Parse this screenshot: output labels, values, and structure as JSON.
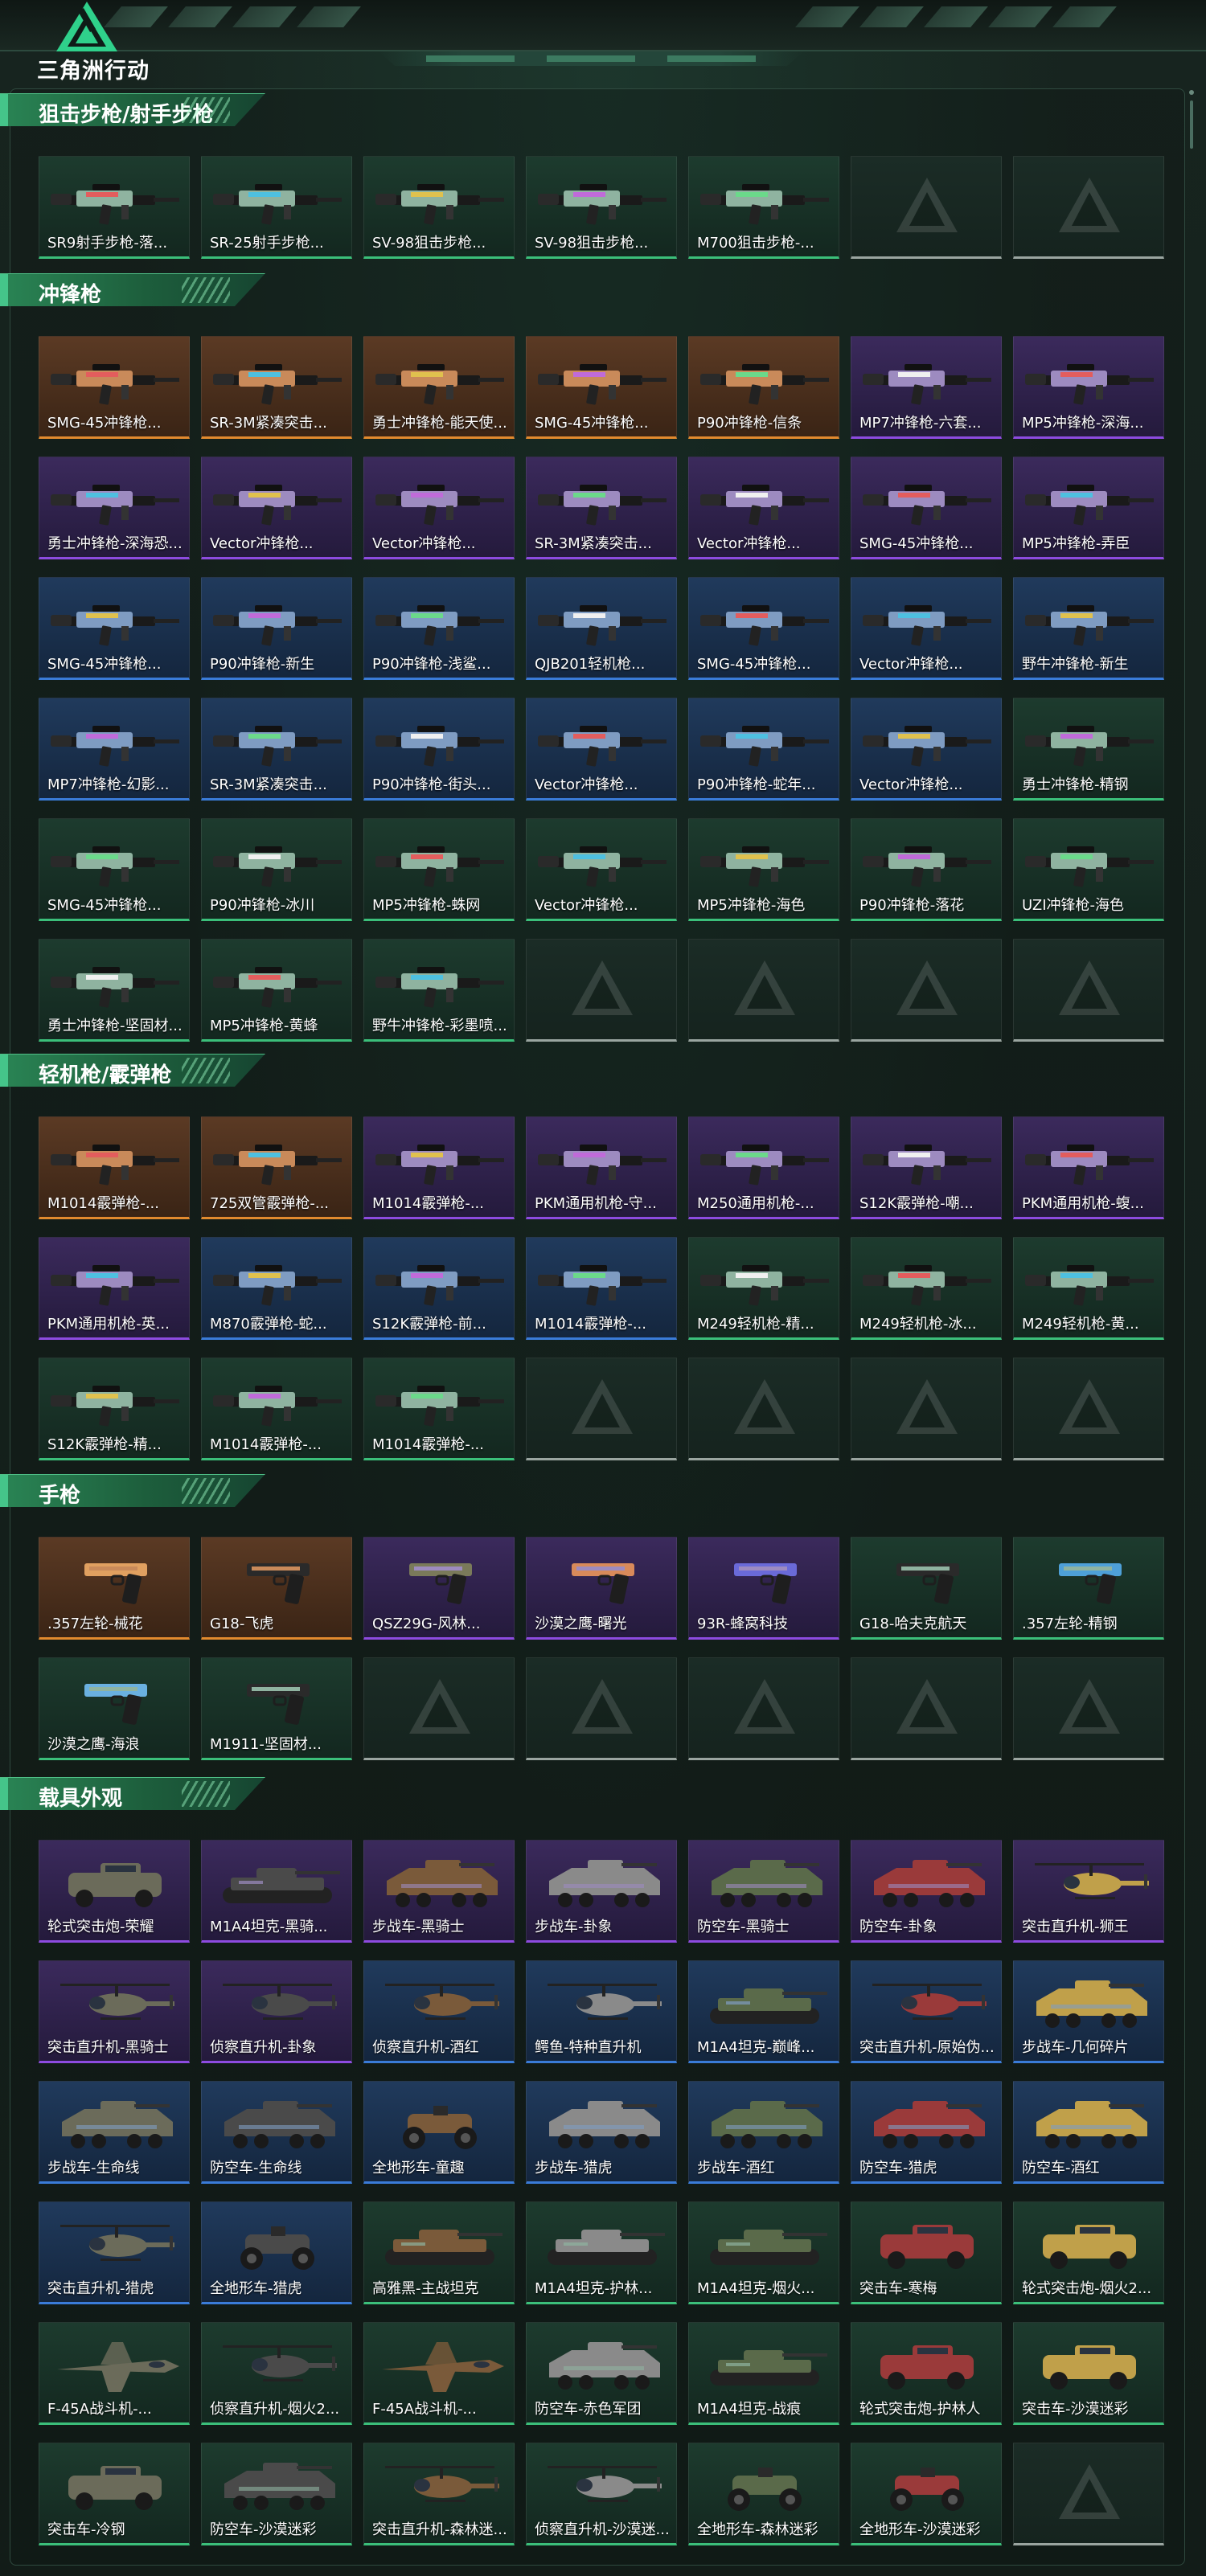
{
  "brand": {
    "name": "三角洲行动"
  },
  "sections": [
    {
      "title": "狙击步枪/射手步枪",
      "type": "gun",
      "items": [
        {
          "name": "SR9射手步枪-落...",
          "rarity": "green"
        },
        {
          "name": "SR-25射手步枪...",
          "rarity": "green"
        },
        {
          "name": "SV-98狙击步枪...",
          "rarity": "green"
        },
        {
          "name": "SV-98狙击步枪...",
          "rarity": "green"
        },
        {
          "name": "M700狙击步枪-...",
          "rarity": "green"
        }
      ],
      "empty_slots": 2
    },
    {
      "title": "冲锋枪",
      "type": "smg",
      "items": [
        {
          "name": "SMG-45冲锋枪...",
          "rarity": "orange"
        },
        {
          "name": "SR-3M紧凑突击...",
          "rarity": "orange"
        },
        {
          "name": "勇士冲锋枪-能天使...",
          "rarity": "orange"
        },
        {
          "name": "SMG-45冲锋枪...",
          "rarity": "orange"
        },
        {
          "name": "P90冲锋枪-信条",
          "rarity": "orange"
        },
        {
          "name": "MP7冲锋枪-六套...",
          "rarity": "purple"
        },
        {
          "name": "MP5冲锋枪-深海...",
          "rarity": "purple"
        },
        {
          "name": "勇士冲锋枪-深海恐...",
          "rarity": "purple"
        },
        {
          "name": "Vector冲锋枪...",
          "rarity": "purple"
        },
        {
          "name": "Vector冲锋枪...",
          "rarity": "purple"
        },
        {
          "name": "SR-3M紧凑突击...",
          "rarity": "purple"
        },
        {
          "name": "Vector冲锋枪...",
          "rarity": "purple"
        },
        {
          "name": "SMG-45冲锋枪...",
          "rarity": "purple"
        },
        {
          "name": "MP5冲锋枪-弄臣",
          "rarity": "purple"
        },
        {
          "name": "SMG-45冲锋枪...",
          "rarity": "blue"
        },
        {
          "name": "P90冲锋枪-新生",
          "rarity": "blue"
        },
        {
          "name": "P90冲锋枪-浅鲨...",
          "rarity": "blue"
        },
        {
          "name": "QJB201轻机枪...",
          "rarity": "blue"
        },
        {
          "name": "SMG-45冲锋枪...",
          "rarity": "blue"
        },
        {
          "name": "Vector冲锋枪...",
          "rarity": "blue"
        },
        {
          "name": "野牛冲锋枪-新生",
          "rarity": "blue"
        },
        {
          "name": "MP7冲锋枪-幻影...",
          "rarity": "blue"
        },
        {
          "name": "SR-3M紧凑突击...",
          "rarity": "blue"
        },
        {
          "name": "P90冲锋枪-街头...",
          "rarity": "blue"
        },
        {
          "name": "Vector冲锋枪...",
          "rarity": "blue"
        },
        {
          "name": "P90冲锋枪-蛇年...",
          "rarity": "blue"
        },
        {
          "name": "Vector冲锋枪...",
          "rarity": "blue"
        },
        {
          "name": "勇士冲锋枪-精钢",
          "rarity": "green"
        },
        {
          "name": "SMG-45冲锋枪...",
          "rarity": "green"
        },
        {
          "name": "P90冲锋枪-冰川",
          "rarity": "green"
        },
        {
          "name": "MP5冲锋枪-蛛网",
          "rarity": "green"
        },
        {
          "name": "Vector冲锋枪...",
          "rarity": "green"
        },
        {
          "name": "MP5冲锋枪-海色",
          "rarity": "green"
        },
        {
          "name": "P90冲锋枪-落花",
          "rarity": "green"
        },
        {
          "name": "UZI冲锋枪-海色",
          "rarity": "green"
        },
        {
          "name": "勇士冲锋枪-坚固材...",
          "rarity": "green"
        },
        {
          "name": "MP5冲锋枪-黄蜂",
          "rarity": "green"
        },
        {
          "name": "野牛冲锋枪-彩墨喷...",
          "rarity": "green"
        }
      ],
      "empty_slots": 4
    },
    {
      "title": "轻机枪/霰弹枪",
      "type": "gun",
      "items": [
        {
          "name": "M1014霰弹枪-...",
          "rarity": "orange"
        },
        {
          "name": "725双管霰弹枪-...",
          "rarity": "orange"
        },
        {
          "name": "M1014霰弹枪-...",
          "rarity": "purple"
        },
        {
          "name": "PKM通用机枪-守...",
          "rarity": "purple"
        },
        {
          "name": "M250通用机枪-...",
          "rarity": "purple"
        },
        {
          "name": "S12K霰弹枪-嘲...",
          "rarity": "purple"
        },
        {
          "name": "PKM通用机枪-蝮...",
          "rarity": "purple"
        },
        {
          "name": "PKM通用机枪-英...",
          "rarity": "purple"
        },
        {
          "name": "M870霰弹枪-蛇...",
          "rarity": "blue"
        },
        {
          "name": "S12K霰弹枪-前...",
          "rarity": "blue"
        },
        {
          "name": "M1014霰弹枪-...",
          "rarity": "blue"
        },
        {
          "name": "M249轻机枪-精...",
          "rarity": "green"
        },
        {
          "name": "M249轻机枪-冰...",
          "rarity": "green"
        },
        {
          "name": "M249轻机枪-黄...",
          "rarity": "green"
        },
        {
          "name": "S12K霰弹枪-精...",
          "rarity": "green"
        },
        {
          "name": "M1014霰弹枪-...",
          "rarity": "green"
        },
        {
          "name": "M1014霰弹枪-...",
          "rarity": "green"
        }
      ],
      "empty_slots": 4
    },
    {
      "title": "手枪",
      "type": "pistol",
      "items": [
        {
          "name": ".357左轮-械花",
          "rarity": "orange"
        },
        {
          "name": "G18-飞虎",
          "rarity": "orange"
        },
        {
          "name": "QSZ29G-风林...",
          "rarity": "purple"
        },
        {
          "name": "沙漠之鹰-曙光",
          "rarity": "purple"
        },
        {
          "name": "93R-蜂窝科技",
          "rarity": "purple"
        },
        {
          "name": "G18-哈夫克航天",
          "rarity": "green"
        },
        {
          "name": ".357左轮-精钢",
          "rarity": "green"
        },
        {
          "name": "沙漠之鹰-海浪",
          "rarity": "green"
        },
        {
          "name": "M1911-坚固材...",
          "rarity": "green"
        }
      ],
      "empty_slots": 5
    },
    {
      "title": "载具外观",
      "type": "vehicle",
      "items": [
        {
          "name": "轮式突击炮-荣耀",
          "rarity": "purple",
          "vehicle": "car"
        },
        {
          "name": "M1A4坦克-黑骑...",
          "rarity": "purple",
          "vehicle": "tank"
        },
        {
          "name": "步战车-黑骑士",
          "rarity": "purple",
          "vehicle": "apc"
        },
        {
          "name": "步战车-卦象",
          "rarity": "purple",
          "vehicle": "apc"
        },
        {
          "name": "防空车-黑骑士",
          "rarity": "purple",
          "vehicle": "apc"
        },
        {
          "name": "防空车-卦象",
          "rarity": "purple",
          "vehicle": "apc"
        },
        {
          "name": "突击直升机-狮王",
          "rarity": "purple",
          "vehicle": "heli"
        },
        {
          "name": "突击直升机-黑骑士",
          "rarity": "purple",
          "vehicle": "heli"
        },
        {
          "name": "侦察直升机-卦象",
          "rarity": "purple",
          "vehicle": "heli"
        },
        {
          "name": "侦察直升机-酒红",
          "rarity": "blue",
          "vehicle": "heli"
        },
        {
          "name": "鳄鱼-特种直升机",
          "rarity": "blue",
          "vehicle": "heli"
        },
        {
          "name": "M1A4坦克-巅峰...",
          "rarity": "blue",
          "vehicle": "tank"
        },
        {
          "name": "突击直升机-原始伪...",
          "rarity": "blue",
          "vehicle": "heli"
        },
        {
          "name": "步战车-几何碎片",
          "rarity": "blue",
          "vehicle": "apc"
        },
        {
          "name": "步战车-生命线",
          "rarity": "blue",
          "vehicle": "apc"
        },
        {
          "name": "防空车-生命线",
          "rarity": "blue",
          "vehicle": "apc"
        },
        {
          "name": "全地形车-童趣",
          "rarity": "blue",
          "vehicle": "atv"
        },
        {
          "name": "步战车-猎虎",
          "rarity": "blue",
          "vehicle": "apc"
        },
        {
          "name": "步战车-酒红",
          "rarity": "blue",
          "vehicle": "apc"
        },
        {
          "name": "防空车-猎虎",
          "rarity": "blue",
          "vehicle": "apc"
        },
        {
          "name": "防空车-酒红",
          "rarity": "blue",
          "vehicle": "apc"
        },
        {
          "name": "突击直升机-猎虎",
          "rarity": "blue",
          "vehicle": "heli"
        },
        {
          "name": "全地形车-猎虎",
          "rarity": "blue",
          "vehicle": "atv"
        },
        {
          "name": "高雅黑-主战坦克",
          "rarity": "green",
          "vehicle": "tank"
        },
        {
          "name": "M1A4坦克-护林...",
          "rarity": "green",
          "vehicle": "tank"
        },
        {
          "name": "M1A4坦克-烟火...",
          "rarity": "green",
          "vehicle": "tank"
        },
        {
          "name": "突击车-寒梅",
          "rarity": "green",
          "vehicle": "car"
        },
        {
          "name": "轮式突击炮-烟火2...",
          "rarity": "green",
          "vehicle": "car"
        },
        {
          "name": "F-45A战斗机-...",
          "rarity": "green",
          "vehicle": "jet"
        },
        {
          "name": "侦察直升机-烟火2...",
          "rarity": "green",
          "vehicle": "heli"
        },
        {
          "name": "F-45A战斗机-...",
          "rarity": "green",
          "vehicle": "jet"
        },
        {
          "name": "防空车-赤色军团",
          "rarity": "green",
          "vehicle": "apc"
        },
        {
          "name": "M1A4坦克-战痕",
          "rarity": "green",
          "vehicle": "tank"
        },
        {
          "name": "轮式突击炮-护林人",
          "rarity": "green",
          "vehicle": "car"
        },
        {
          "name": "突击车-沙漠迷彩",
          "rarity": "green",
          "vehicle": "car"
        },
        {
          "name": "突击车-冷钢",
          "rarity": "green",
          "vehicle": "car"
        },
        {
          "name": "防空车-沙漠迷彩",
          "rarity": "green",
          "vehicle": "apc"
        },
        {
          "name": "突击直升机-森林迷...",
          "rarity": "green",
          "vehicle": "heli"
        },
        {
          "name": "侦察直升机-沙漠迷...",
          "rarity": "green",
          "vehicle": "heli"
        },
        {
          "name": "全地形车-森林迷彩",
          "rarity": "green",
          "vehicle": "atv"
        },
        {
          "name": "全地形车-沙漠迷彩",
          "rarity": "green",
          "vehicle": "atv"
        }
      ],
      "empty_slots": 1
    }
  ],
  "colors": {
    "rarity_orange": "#e28a2e",
    "rarity_purple": "#8d4be0",
    "rarity_blue": "#3a7bd8",
    "rarity_green": "#3bbf7a",
    "accent": "#2a8555",
    "background": "#14201c"
  }
}
